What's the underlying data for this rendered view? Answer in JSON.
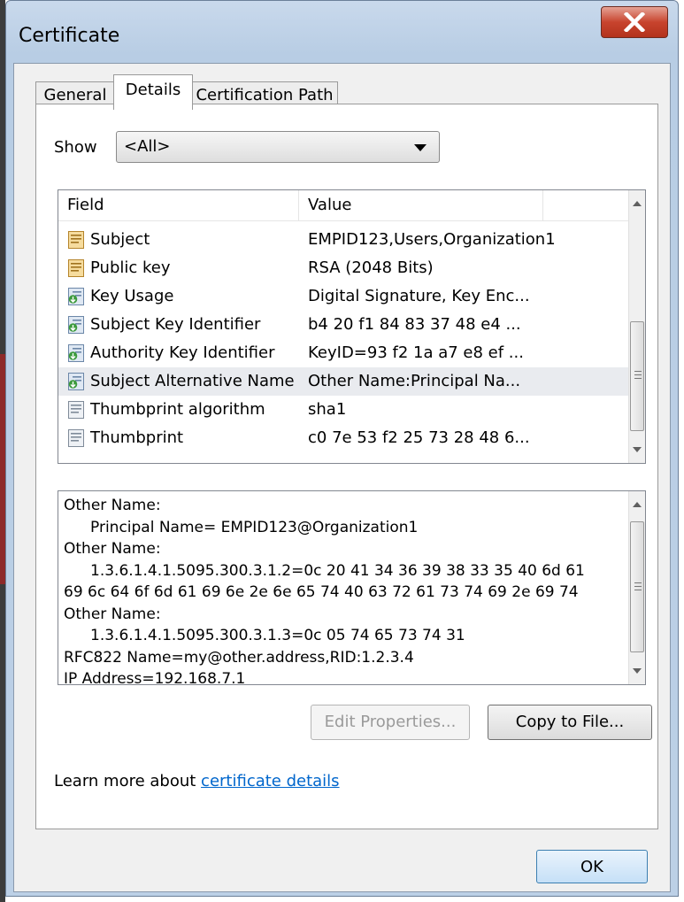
{
  "window": {
    "title": "Certificate",
    "close_label": "X"
  },
  "tabs": [
    {
      "label": "General",
      "active": false
    },
    {
      "label": "Details",
      "active": true
    },
    {
      "label": "Certification Path",
      "active": false
    }
  ],
  "show": {
    "label": "Show",
    "selected": "<All>"
  },
  "table": {
    "headers": {
      "field": "Field",
      "value": "Value"
    },
    "rows": [
      {
        "field": "Subject",
        "value": "EMPID123,Users,Organization1",
        "icon": "certificate-field-icon"
      },
      {
        "field": "Public key",
        "value": "RSA (2048 Bits)",
        "icon": "certificate-field-icon"
      },
      {
        "field": "Key Usage",
        "value": "Digital Signature, Key Enc...",
        "icon": "extension-icon"
      },
      {
        "field": "Subject Key Identifier",
        "value": "b4 20 f1 84 83 37 48 e4 ...",
        "icon": "extension-icon"
      },
      {
        "field": "Authority Key Identifier",
        "value": "KeyID=93 f2 1a a7 e8 ef ...",
        "icon": "extension-icon"
      },
      {
        "field": "Subject Alternative Name",
        "value": "Other Name:Principal Na...",
        "icon": "extension-icon",
        "selected": true
      },
      {
        "field": "Thumbprint algorithm",
        "value": "sha1",
        "icon": "property-icon"
      },
      {
        "field": "Thumbprint",
        "value": "c0 7e 53 f2 25 73 28 48 6...",
        "icon": "property-icon"
      }
    ]
  },
  "details_text": [
    "Other Name:",
    "Principal Name= EMPID123@Organization1",
    "Other Name:",
    "1.3.6.1.4.1.5095.300.3.1.2=0c 20 41 34 36 39 38 33 35 40 6d 61",
    "69 6c 64 6f 6d 61 69 6e 2e 6e 65 74 40 63 72 61 73 74 69 2e 69 74",
    "Other Name:",
    "1.3.6.1.4.1.5095.300.3.1.3=0c 05 74 65 73 74 31",
    "RFC822 Name=my@other.address,RID:1.2.3.4",
    "IP Address=192.168.7.1"
  ],
  "buttons": {
    "edit_properties": "Edit Properties...",
    "copy_to_file": "Copy to File...",
    "ok": "OK"
  },
  "learn_more": {
    "prefix": "Learn more about ",
    "link": "certificate details"
  },
  "colors": {
    "link": "#0066cc",
    "close_button": "#c8442e",
    "selected_row": "#e9ebef"
  }
}
